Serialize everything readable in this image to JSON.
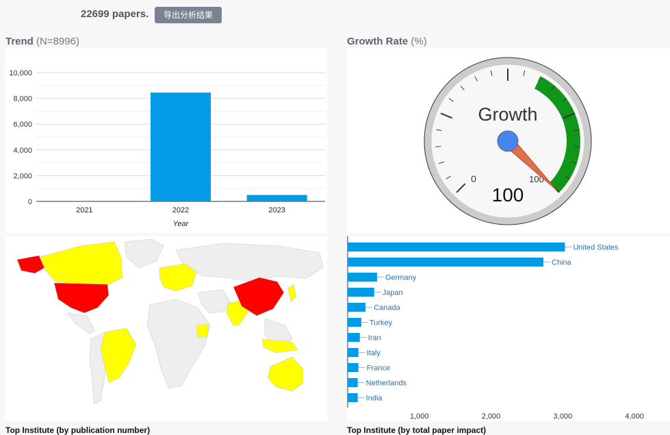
{
  "header": {
    "count": "22699 papers.",
    "export_label": "导出分析结果"
  },
  "trend": {
    "title": "Trend",
    "subtitle": "(N=8996)"
  },
  "growth": {
    "title": "Growth Rate",
    "subtitle": "(%)"
  },
  "bottom": {
    "left_label": "Top Institute (by publication number)",
    "right_label": "Top Institute (by total paper impact)"
  },
  "chart_data": [
    {
      "type": "bar",
      "categories": [
        "2021",
        "2022",
        "2023"
      ],
      "values": [
        0,
        8450,
        500
      ],
      "xlabel": "Year",
      "ylabel": "",
      "ylim": [
        0,
        10000
      ],
      "yticks": [
        "0",
        "2,000",
        "4,000",
        "6,000",
        "8,000",
        "10,000"
      ],
      "color": "#039be5",
      "grid": true
    },
    {
      "type": "gauge",
      "label": "Growth",
      "value": 100,
      "min": 0,
      "max": 100,
      "value_text": "100",
      "min_label": "0",
      "max_label": "100",
      "green_band": [
        60,
        100
      ],
      "needle_color": "#e0704a",
      "band_color": "#109618"
    },
    {
      "type": "map",
      "regions_high": [
        "United States",
        "China",
        "Alaska"
      ],
      "regions_mid": [
        "Canada",
        "Brazil",
        "Australia",
        "India",
        "Europe"
      ],
      "high_color": "#ff0000",
      "mid_color": "#ffff00",
      "other_color": "#f2f2f2"
    },
    {
      "type": "bar",
      "orientation": "horizontal",
      "categories": [
        "United States",
        "China",
        "Germany",
        "Japan",
        "Canada",
        "Turkey",
        "Iran",
        "Italy",
        "France",
        "Netherlands",
        "India"
      ],
      "values": [
        3030,
        2730,
        410,
        370,
        250,
        190,
        170,
        150,
        150,
        140,
        140
      ],
      "xlim": [
        0,
        4400
      ],
      "xticks": [
        "1,000",
        "2,000",
        "3,000",
        "4,000"
      ],
      "color": "#039be5",
      "label_color": "#1a73b8"
    }
  ]
}
